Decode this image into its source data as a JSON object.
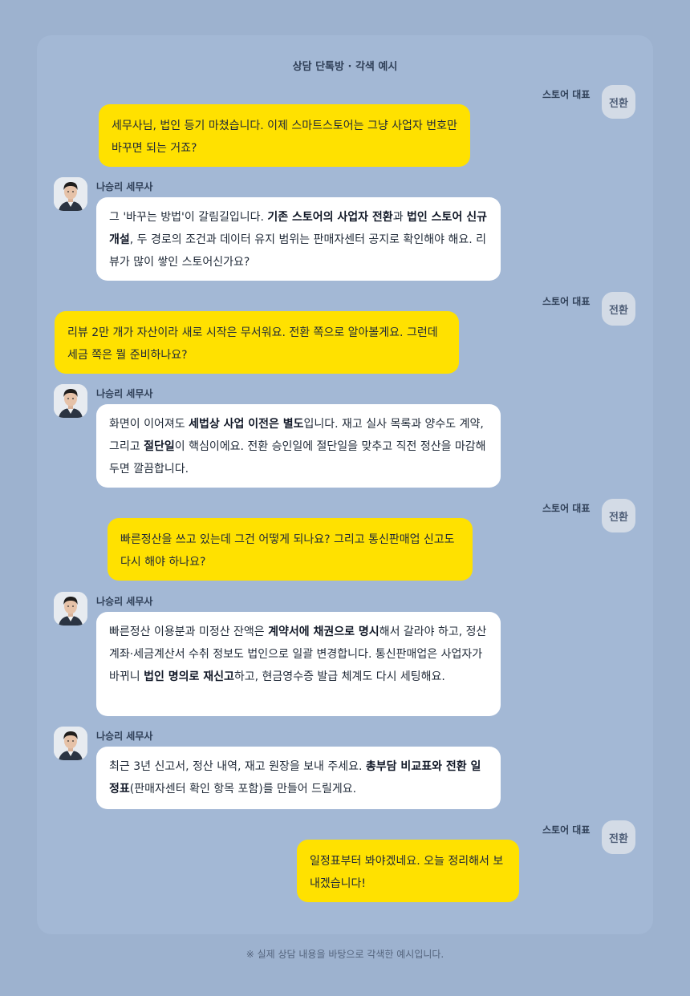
{
  "page": {
    "title": "상담 단톡방 · 각색 예시",
    "footnote": "※ 실제 상담 내용을 바탕으로 각색한 예시입니다."
  },
  "participants": {
    "user": {
      "name": "스토어 대표",
      "avatar_text": "전환"
    },
    "advisor": {
      "name": "나승리 세무사",
      "avatar": "advisor-portrait"
    }
  },
  "colors": {
    "background": "#9db2cf",
    "panel": "#a3b8d5",
    "user_bubble": "#ffe100",
    "advisor_bubble": "#ffffff"
  },
  "messages": [
    {
      "sender": "스토어 대표",
      "parts": [
        {
          "t": "세무사님, 법인 등기 마쳤습니다. 이제 스마트스토어는 그냥 사업자 번호만 바꾸면 되는 거죠?"
        }
      ]
    },
    {
      "sender": "나승리 세무사",
      "parts": [
        {
          "t": "그 '바꾸는 방법'이 갈림길입니다. "
        },
        {
          "t": "기존 스토어의 사업자 전환",
          "b": true
        },
        {
          "t": "과 "
        },
        {
          "t": "법인 스토어 신규 개설",
          "b": true
        },
        {
          "t": ", 두 경로의 조건과 데이터 유지 범위는 판매자센터 공지로 확인해야 해요. 리뷰가 많이 쌓인 스토어신가요?"
        }
      ]
    },
    {
      "sender": "스토어 대표",
      "parts": [
        {
          "t": "리뷰 2만 개가 자산이라 새로 시작은 무서워요. 전환 쪽으로 알아볼게요. 그런데 세금 쪽은 뭘 준비하나요?"
        }
      ]
    },
    {
      "sender": "나승리 세무사",
      "parts": [
        {
          "t": "화면이 이어져도 "
        },
        {
          "t": "세법상 사업 이전은 별도",
          "b": true
        },
        {
          "t": "입니다. 재고 실사 목록과 양수도 계약, 그리고 "
        },
        {
          "t": "절단일",
          "b": true
        },
        {
          "t": "이 핵심이에요. 전환 승인일에 절단일을 맞추고 직전 정산을 마감해 두면 깔끔합니다."
        }
      ]
    },
    {
      "sender": "스토어 대표",
      "parts": [
        {
          "t": "빠른정산을 쓰고 있는데 그건 어떻게 되나요? 그리고 통신판매업 신고도 다시 해야 하나요?"
        }
      ]
    },
    {
      "sender": "나승리 세무사",
      "parts": [
        {
          "t": "빠른정산 이용분과 미정산 잔액은 "
        },
        {
          "t": "계약서에 채권으로 명시",
          "b": true
        },
        {
          "t": "해서 갈라야 하고, 정산 계좌·세금계산서 수취 정보도 법인으로 일괄 변경합니다. 통신판매업은 사업자가 바뀌니 "
        },
        {
          "t": "법인 명의로 재신고",
          "b": true
        },
        {
          "t": "하고, 현금영수증 발급 체계도 다시 세팅해요."
        }
      ]
    },
    {
      "sender": "나승리 세무사",
      "parts": [
        {
          "t": "최근 3년 신고서, 정산 내역, 재고 원장을 보내 주세요. "
        },
        {
          "t": "총부담 비교표와 전환 일정표",
          "b": true
        },
        {
          "t": "(판매자센터 확인 항목 포함)를 만들어 드릴게요."
        }
      ]
    },
    {
      "sender": "스토어 대표",
      "parts": [
        {
          "t": "일정표부터 봐야겠네요. 오늘 정리해서 보내겠습니다!"
        }
      ]
    }
  ]
}
